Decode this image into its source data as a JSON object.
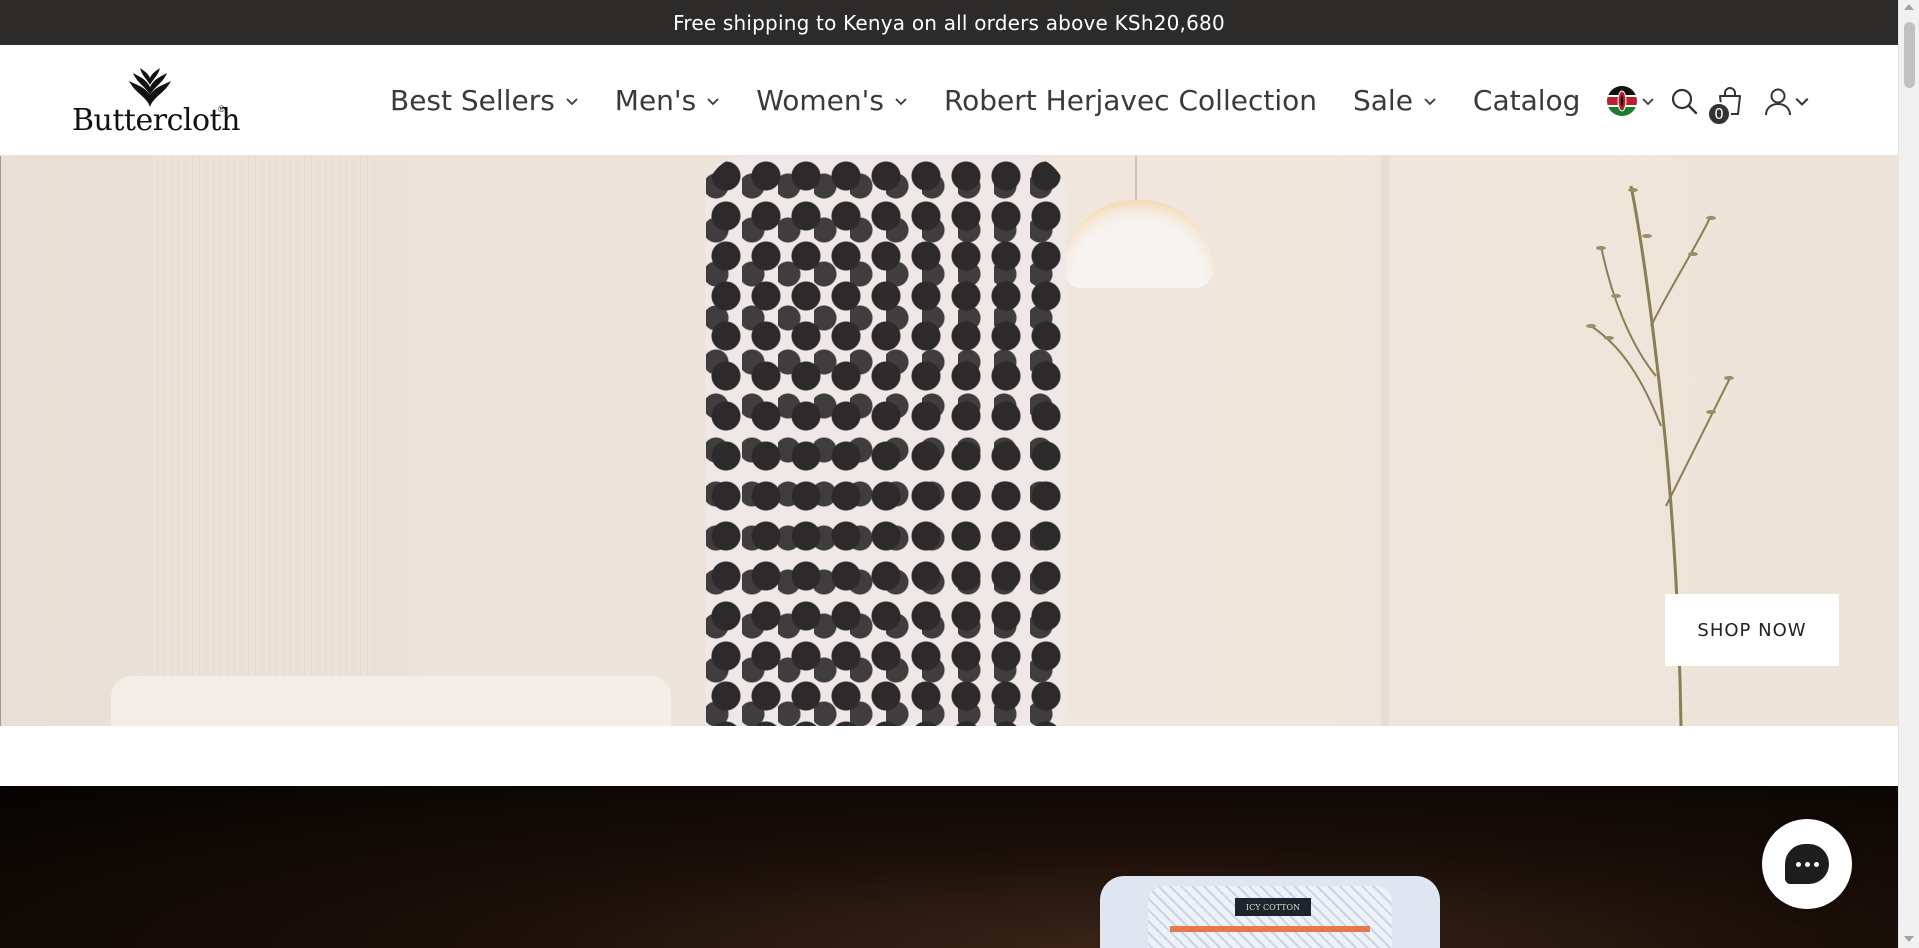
{
  "announcement": {
    "text": "Free shipping to Kenya on all orders above KSh20,680"
  },
  "header": {
    "logo_text": "Buttercloth",
    "logo_reg": "®",
    "nav": [
      {
        "label": "Best Sellers",
        "has_dropdown": true
      },
      {
        "label": "Men's",
        "has_dropdown": true
      },
      {
        "label": "Women's",
        "has_dropdown": true
      },
      {
        "label": "Robert Herjavec Collection",
        "has_dropdown": false
      },
      {
        "label": "Sale",
        "has_dropdown": true
      },
      {
        "label": "Catalog",
        "has_dropdown": false
      }
    ],
    "icons": {
      "country": "kenya-flag-icon",
      "search": "search-icon",
      "cart": "shopping-bag-icon",
      "account": "user-icon"
    },
    "cart_count": "0"
  },
  "hero": {
    "cta_label": "SHOP NOW"
  },
  "promo": {
    "tag_text": "ICY COTTON"
  },
  "chat": {
    "icon": "chat-icon"
  },
  "colors": {
    "announcement_bg": "#2d2a2a",
    "text": "#3a3a3a",
    "accent_dark": "#1d1d1d"
  }
}
